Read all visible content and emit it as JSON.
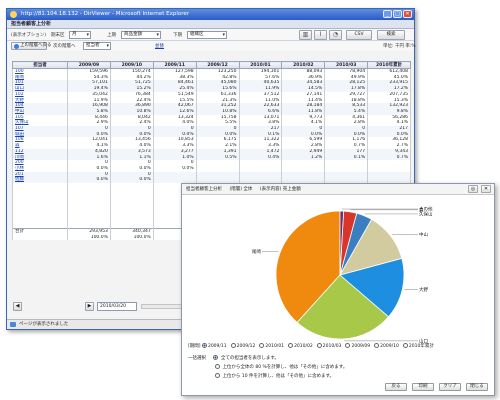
{
  "window": {
    "title": "http://81.104.18.132 - DirViewer - Microsoft Internet Explorer",
    "min": "_",
    "max": "□",
    "close": "✕"
  },
  "app": {
    "header": "担当者顧客上分析",
    "options_label": "(表示オプション)",
    "unit_label": "期末区",
    "unit_value": "月",
    "span_label": "上期",
    "span_value": "商品金額",
    "filter_label": "下期",
    "filter_value": "組織区",
    "csv_label": "CSV",
    "print_label": "検索",
    "back_label": "上の階層へ戻る",
    "group_label": "次の階層へ",
    "group_value": "担当者",
    "sort_link": "並替",
    "unit_note": "単位: 千円 率:%"
  },
  "table": {
    "columns": [
      "担当者",
      "2009/09",
      "2009/10",
      "2009/11",
      "2009/12",
      "2010/01",
      "2010/02",
      "2010/03",
      "2010年累計"
    ],
    "rows": [
      [
        "100",
        "159,596",
        "150,274",
        "127,598",
        "123,250",
        "194,301",
        "88,093",
        "78,904",
        "612,408"
      ],
      [
        "尾崎",
        "54.3%",
        "44.2%",
        "38.3%",
        "42.8%",
        "57.6%",
        "36.9%",
        "49.9%",
        "45.0%"
      ],
      [
        "101",
        "57,101",
        "51,725",
        "84,461",
        "45,080",
        "40,635",
        "34,583",
        "28,125",
        "233,915"
      ],
      [
        "山口",
        "19.4%",
        "15.2%",
        "25.4%",
        "15.6%",
        "11.9%",
        "14.5%",
        "17.8%",
        "17.2%"
      ],
      [
        "102",
        "35,042",
        "76,384",
        "51,549",
        "61,336",
        "37,512",
        "27,141",
        "29,727",
        "207,735"
      ],
      [
        "大野",
        "11.9%",
        "22.4%",
        "15.5%",
        "21.3%",
        "11.0%",
        "11.4%",
        "18.8%",
        "15.3%"
      ],
      [
        "104",
        "16,908",
        "36,890",
        "42,067",
        "31,252",
        "22,633",
        "28,184",
        "8,533",
        "132,923"
      ],
      [
        "中山",
        "5.8%",
        "10.8%",
        "12.6%",
        "10.8%",
        "6.6%",
        "11.8%",
        "5.4%",
        "9.8%"
      ],
      [
        "105",
        "8,446",
        "8,042",
        "13,324",
        "15,758",
        "13,071",
        "9,773",
        "4,361",
        "56,286"
      ],
      [
        "久保山",
        "2.9%",
        "2.4%",
        "4.0%",
        "5.5%",
        "3.8%",
        "4.1%",
        "2.8%",
        "4.1%"
      ],
      [
        "107",
        "0",
        "0",
        "0",
        "0",
        "217",
        "0",
        "0",
        "217"
      ],
      [
        "城田",
        "0.0%",
        "0.0%",
        "0.0%",
        "0.0%",
        "0.1%",
        "0.0%",
        "0.0%",
        "0.0%"
      ],
      [
        "108",
        "12,041",
        "13,456",
        "10,853",
        "6,175",
        "11,322",
        "6,599",
        "1,176",
        "36,128"
      ],
      [
        "森",
        "4.1%",
        "4.0%",
        "3.3%",
        "2.1%",
        "3.3%",
        "2.8%",
        "0.7%",
        "2.7%"
      ],
      [
        "112",
        "4,820",
        "3,573",
        "3,277",
        "1,391",
        "1,472",
        "2,949",
        "177",
        "9,343"
      ],
      [
        "川崎",
        "1.6%",
        "1.1%",
        "1.0%",
        "0.5%",
        "0.4%",
        "1.2%",
        "0.1%",
        "0.7%"
      ],
      [
        "200",
        "0",
        "0",
        "0",
        "",
        "",
        "",
        "",
        ""
      ],
      [
        "小林",
        "0.0%",
        "0.0%",
        "0.0%",
        "",
        "",
        "",
        "",
        ""
      ],
      [
        "201",
        "0",
        "0",
        "",
        "",
        "",
        "",
        "",
        ""
      ],
      [
        "佐藤",
        "0.0%",
        "0.0%",
        "",
        "",
        "",
        "",
        "",
        ""
      ]
    ],
    "total": [
      "合計",
      "293,953",
      "340,347",
      "",
      "",
      "",
      "",
      "",
      ""
    ],
    "total_pct": [
      "",
      "100.0%",
      "100.0%",
      "",
      "",
      "",
      "",
      "",
      ""
    ]
  },
  "bottom": {
    "date_value": "2010/03/20",
    "prev": "◀",
    "next": "▶"
  },
  "status": {
    "text": "ページが表示されました"
  },
  "chart_window": {
    "header_a": "担当者顧客上分析",
    "header_b": "(階層) 全体",
    "header_c": "(表示内容) 売上金額",
    "icon_a": "◎",
    "icon_b": "✕",
    "period_label": "[期間]",
    "periods": [
      "2009/11",
      "2009/12",
      "2010/01",
      "2010/02",
      "2010/03",
      "2009/09",
      "2009/10",
      "2010年累計"
    ],
    "selected_period": "2009/11",
    "threshold_label": "一括選択",
    "filter_rows": [
      "全ての担当者を表示します。",
      "上位から全体の 80 %を計算し、他は「その他」に含めます。",
      "上位から 10 件を計算し、他は「その他」に含めます。"
    ],
    "buttons": [
      "戻る",
      "印刷",
      "クリア",
      "閉じる"
    ]
  },
  "chart_data": {
    "type": "pie",
    "title": "",
    "slices": [
      {
        "label": "尾崎",
        "value": 38.3,
        "color": "#f08a0f"
      },
      {
        "label": "山口",
        "value": 25.4,
        "color": "#a8c84a"
      },
      {
        "label": "大野",
        "value": 15.5,
        "color": "#1e8fe0"
      },
      {
        "label": "中山",
        "value": 12.6,
        "color": "#d2cba0"
      },
      {
        "label": "久保山",
        "value": 4.0,
        "color": "#3b7fc2"
      },
      {
        "label": "森",
        "value": 3.3,
        "color": "#d9362a"
      },
      {
        "label": "その他",
        "value": 0.9,
        "color": "#6e2a6e"
      }
    ]
  }
}
